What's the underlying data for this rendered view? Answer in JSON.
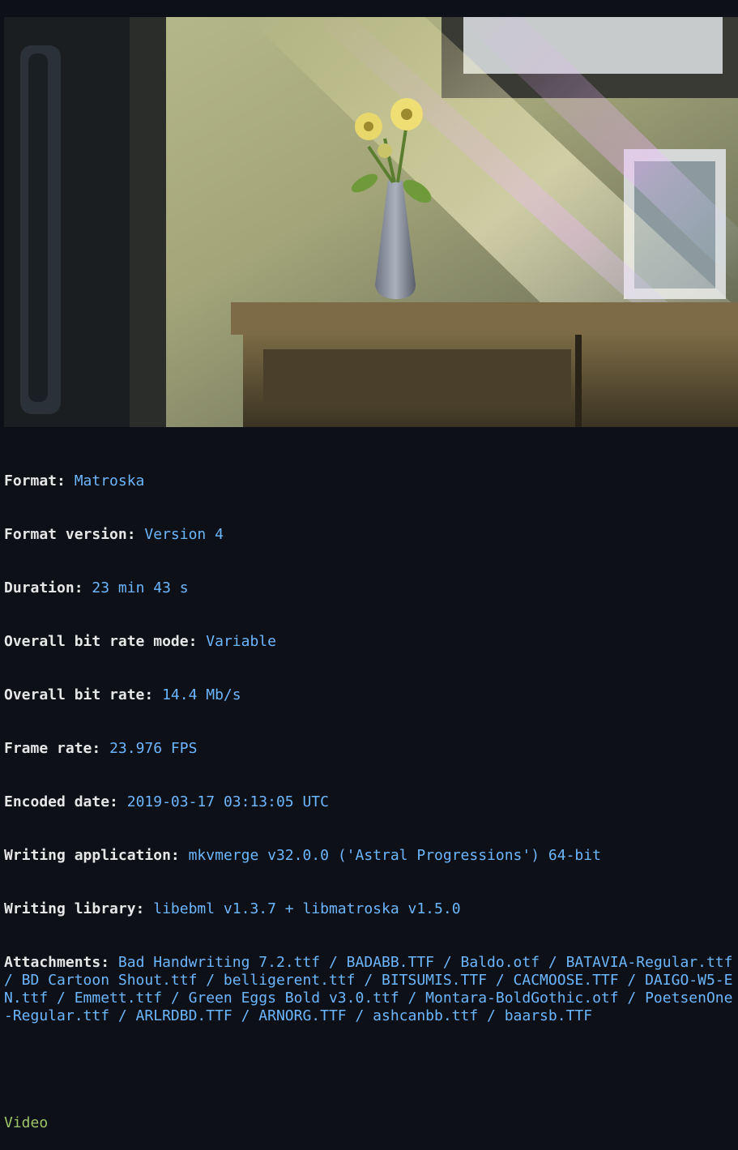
{
  "image": {
    "description_icon": "anime-scene-image"
  },
  "info": {
    "rows": [
      {
        "key": "Format:",
        "value": "Matroska"
      },
      {
        "key": "Format version:",
        "value": "Version 4"
      },
      {
        "key": "Duration:",
        "value": "23 min 43 s"
      },
      {
        "key": "Overall bit rate mode:",
        "value": "Variable"
      },
      {
        "key": "Overall bit rate:",
        "value": "14.4 Mb/s"
      },
      {
        "key": "Frame rate:",
        "value": "23.976 FPS"
      },
      {
        "key": "Encoded date:",
        "value": "2019-03-17 03:13:05 UTC"
      },
      {
        "key": "Writing application:",
        "value": "mkvmerge v32.0.0 ('Astral Progressions') 64-bit"
      },
      {
        "key": "Writing library:",
        "value": "libebml v1.3.7 + libmatroska v1.5.0"
      }
    ],
    "attachments": {
      "key": "Attachments:",
      "value": "Bad Handwriting 7.2.ttf / BADABB.TTF / Baldo.otf / BATAVIA-Regular.ttf / BD Cartoon Shout.ttf / belligerent.ttf / BITSUMIS.TTF / CACMOOSE.TTF / DAIGO-W5-EN.ttf / Emmett.ttf / Green Eggs Bold v3.0.ttf / Montara-BoldGothic.otf / PoetsenOne-Regular.ttf / ARLRDBD.TTF / ARNORG.TTF / ashcanbb.ttf / baarsb.TTF"
    },
    "section": "Video"
  },
  "colors": {
    "background": "#0d1117",
    "key": "#e6e6e6",
    "value": "#6cb6ff",
    "section": "#9ec46a"
  }
}
